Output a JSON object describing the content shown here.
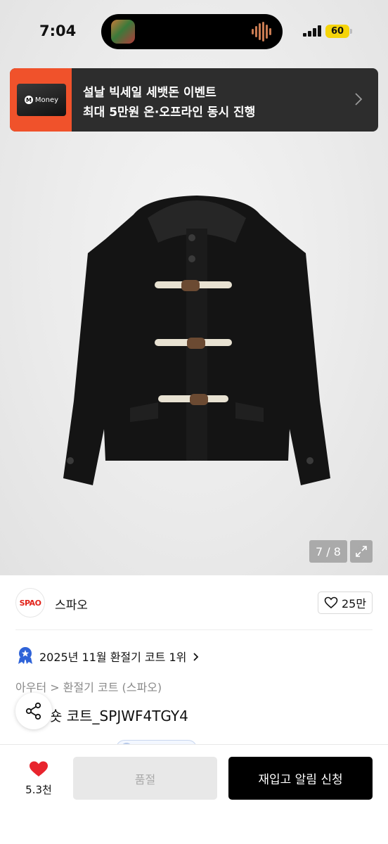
{
  "status_bar": {
    "time": "7:04",
    "battery": "60"
  },
  "ad_banner": {
    "card_brand": "Money",
    "line1": "설날 빅세일 세뱃돈 이벤트",
    "line2": "최대 5만원 온·오프라인 동시 진행"
  },
  "gallery": {
    "counter": "7 / 8"
  },
  "brand": {
    "logo_text": "SPAO",
    "name": "스파오",
    "likes": "25만"
  },
  "ranking": {
    "text": "2025년 11월 환절기 코트 1위"
  },
  "product": {
    "breadcrumb": "아우터 > 환절기 코트 (스파오)",
    "title": "숏 코트_SPJWF4TGY4"
  },
  "bottom_bar": {
    "heart_count": "5.3천",
    "soldout_label": "품절",
    "restock_label": "재입고 알림 신청"
  },
  "icons": {
    "signal": "signal-icon",
    "wave": "audio-wave-icon",
    "chevron": "chevron-right-icon",
    "expand": "expand-icon",
    "heart_outline": "heart-outline-icon",
    "rank": "rank-badge-icon",
    "share": "share-icon",
    "heart_filled": "heart-filled-icon"
  },
  "colors": {
    "accent_red": "#e8242d",
    "banner_bg": "#2d2d2d",
    "banner_thumb": "#f0522b",
    "rank_blue": "#2f63d8",
    "restock_bg": "#000000",
    "soldout_bg": "#e8e8e8"
  }
}
